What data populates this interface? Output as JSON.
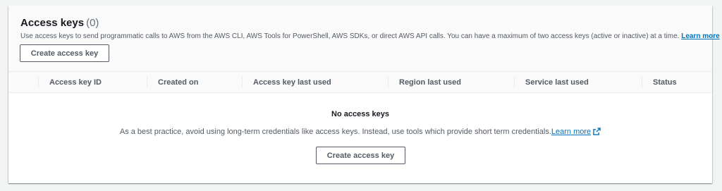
{
  "panel": {
    "title": "Access keys",
    "count": "(0)",
    "description": "Use access keys to send programmatic calls to AWS from the AWS CLI, AWS Tools for PowerShell, AWS SDKs, or direct AWS API calls. You can have a maximum of two access keys (active or inactive) at a time.",
    "learn_more": "Learn more",
    "create_button": "Create access key"
  },
  "table": {
    "columns": [
      "Access key ID",
      "Created on",
      "Access key last used",
      "Region last used",
      "Service last used",
      "Status"
    ]
  },
  "empty_state": {
    "title": "No access keys",
    "text": "As a best practice, avoid using long-term credentials like access keys. Instead, use tools which provide short term credentials.",
    "learn_more": "Learn more",
    "create_button": "Create access key"
  },
  "colors": {
    "link": "#0073bb",
    "page_bg": "#f2f3f3",
    "header_bg": "#fafafa"
  }
}
